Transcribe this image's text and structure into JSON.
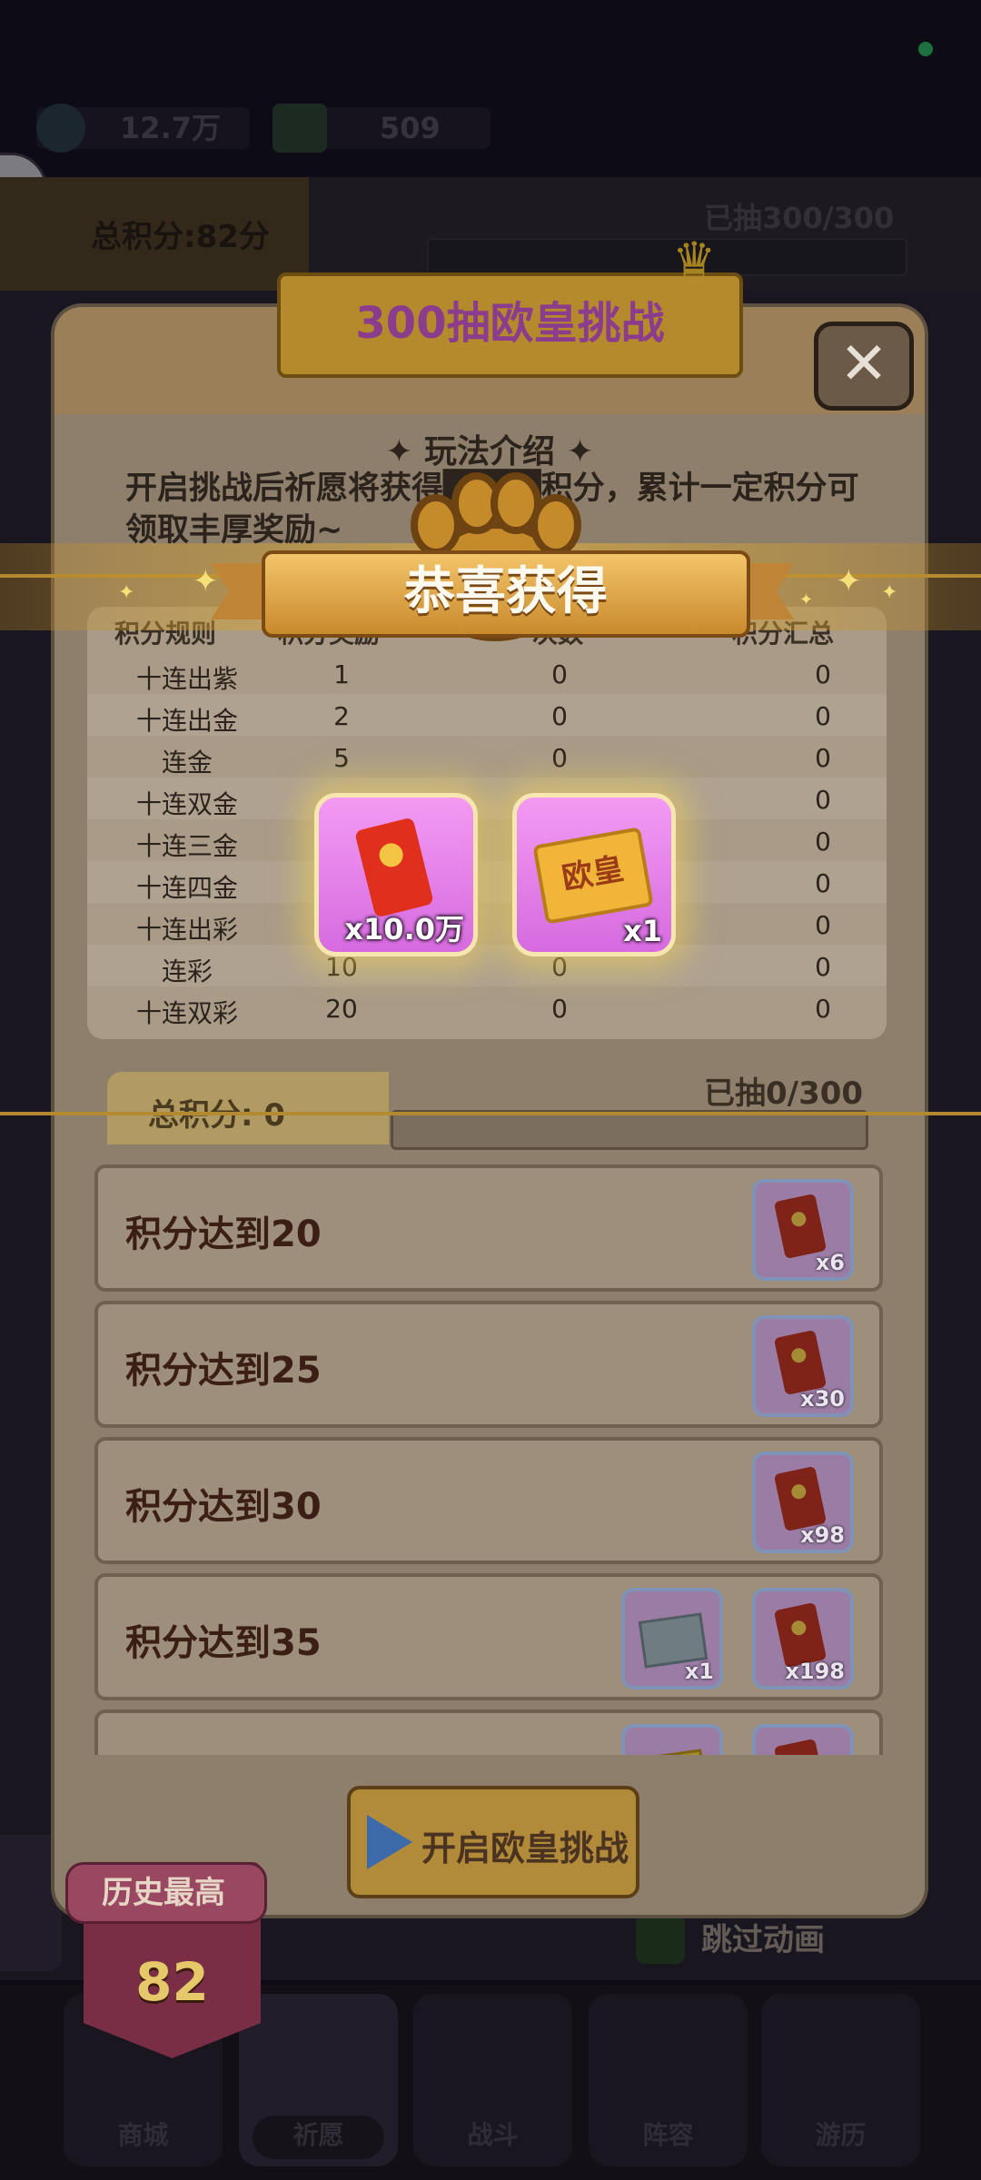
{
  "top_bar": {
    "resource1": "12.7万",
    "resource2": "509"
  },
  "score_strip": {
    "total_score": "总积分:82分",
    "drawn": "已抽300/300"
  },
  "modal": {
    "title": "300抽欧皇挑战",
    "close_glyph": "✕",
    "intro_title": "✦ 玩法介绍 ✦",
    "intro_text": "开启挑战后祈愿将获得████积分，累计一定积分可领取丰厚奖励~"
  },
  "rules": {
    "headers": [
      "积分规则",
      "积分奖励",
      "次数",
      "积分汇总"
    ],
    "rows": [
      {
        "rule": "十连出紫",
        "points": "1",
        "count": "0",
        "total": "0"
      },
      {
        "rule": "十连出金",
        "points": "2",
        "count": "0",
        "total": "0"
      },
      {
        "rule": "连金",
        "points": "5",
        "count": "0",
        "total": "0"
      },
      {
        "rule": "十连双金",
        "points": "",
        "count": "",
        "total": "0"
      },
      {
        "rule": "十连三金",
        "points": "",
        "count": "",
        "total": "0"
      },
      {
        "rule": "十连四金",
        "points": "",
        "count": "",
        "total": "0"
      },
      {
        "rule": "十连出彩",
        "points": "",
        "count": "",
        "total": "0"
      },
      {
        "rule": "连彩",
        "points": "10",
        "count": "0",
        "total": "0"
      },
      {
        "rule": "十连双彩",
        "points": "20",
        "count": "0",
        "total": "0"
      }
    ]
  },
  "progress": {
    "total_label": "总积分: 0",
    "drawn": "已抽0/300"
  },
  "rewards": [
    {
      "label": "积分达到20",
      "items": [
        {
          "type": "red-envelope",
          "qty": "x6"
        }
      ]
    },
    {
      "label": "积分达到25",
      "items": [
        {
          "type": "red-envelope",
          "qty": "x30"
        }
      ]
    },
    {
      "label": "积分达到30",
      "items": [
        {
          "type": "red-envelope",
          "qty": "x98"
        }
      ]
    },
    {
      "label": "积分达到35",
      "items": [
        {
          "type": "ticket",
          "qty": "x1"
        },
        {
          "type": "red-envelope",
          "qty": "x198"
        }
      ]
    },
    {
      "label": "",
      "items": [
        {
          "type": "ticket-gold",
          "qty": ""
        },
        {
          "type": "red-envelope",
          "qty": ""
        }
      ]
    }
  ],
  "start_button": {
    "label": "开启欧皇挑战"
  },
  "history": {
    "label": "历史最高",
    "value": "82"
  },
  "skip": {
    "label": "跳过动画"
  },
  "nav": [
    {
      "label": "商城"
    },
    {
      "label": "祈愿"
    },
    {
      "label": "战斗"
    },
    {
      "label": "阵容"
    },
    {
      "label": "游历"
    }
  ],
  "celebration": {
    "title": "恭喜获得",
    "prizes": [
      {
        "type": "red-envelope",
        "qty": "x10.0万"
      },
      {
        "type": "ouhuang-card",
        "card_text": "欧皇",
        "qty": "x1"
      }
    ]
  },
  "colors": {
    "accent_gold": "#f3c46a",
    "status_dot": "#2ed36b",
    "prize_bg": "#f39af3"
  }
}
